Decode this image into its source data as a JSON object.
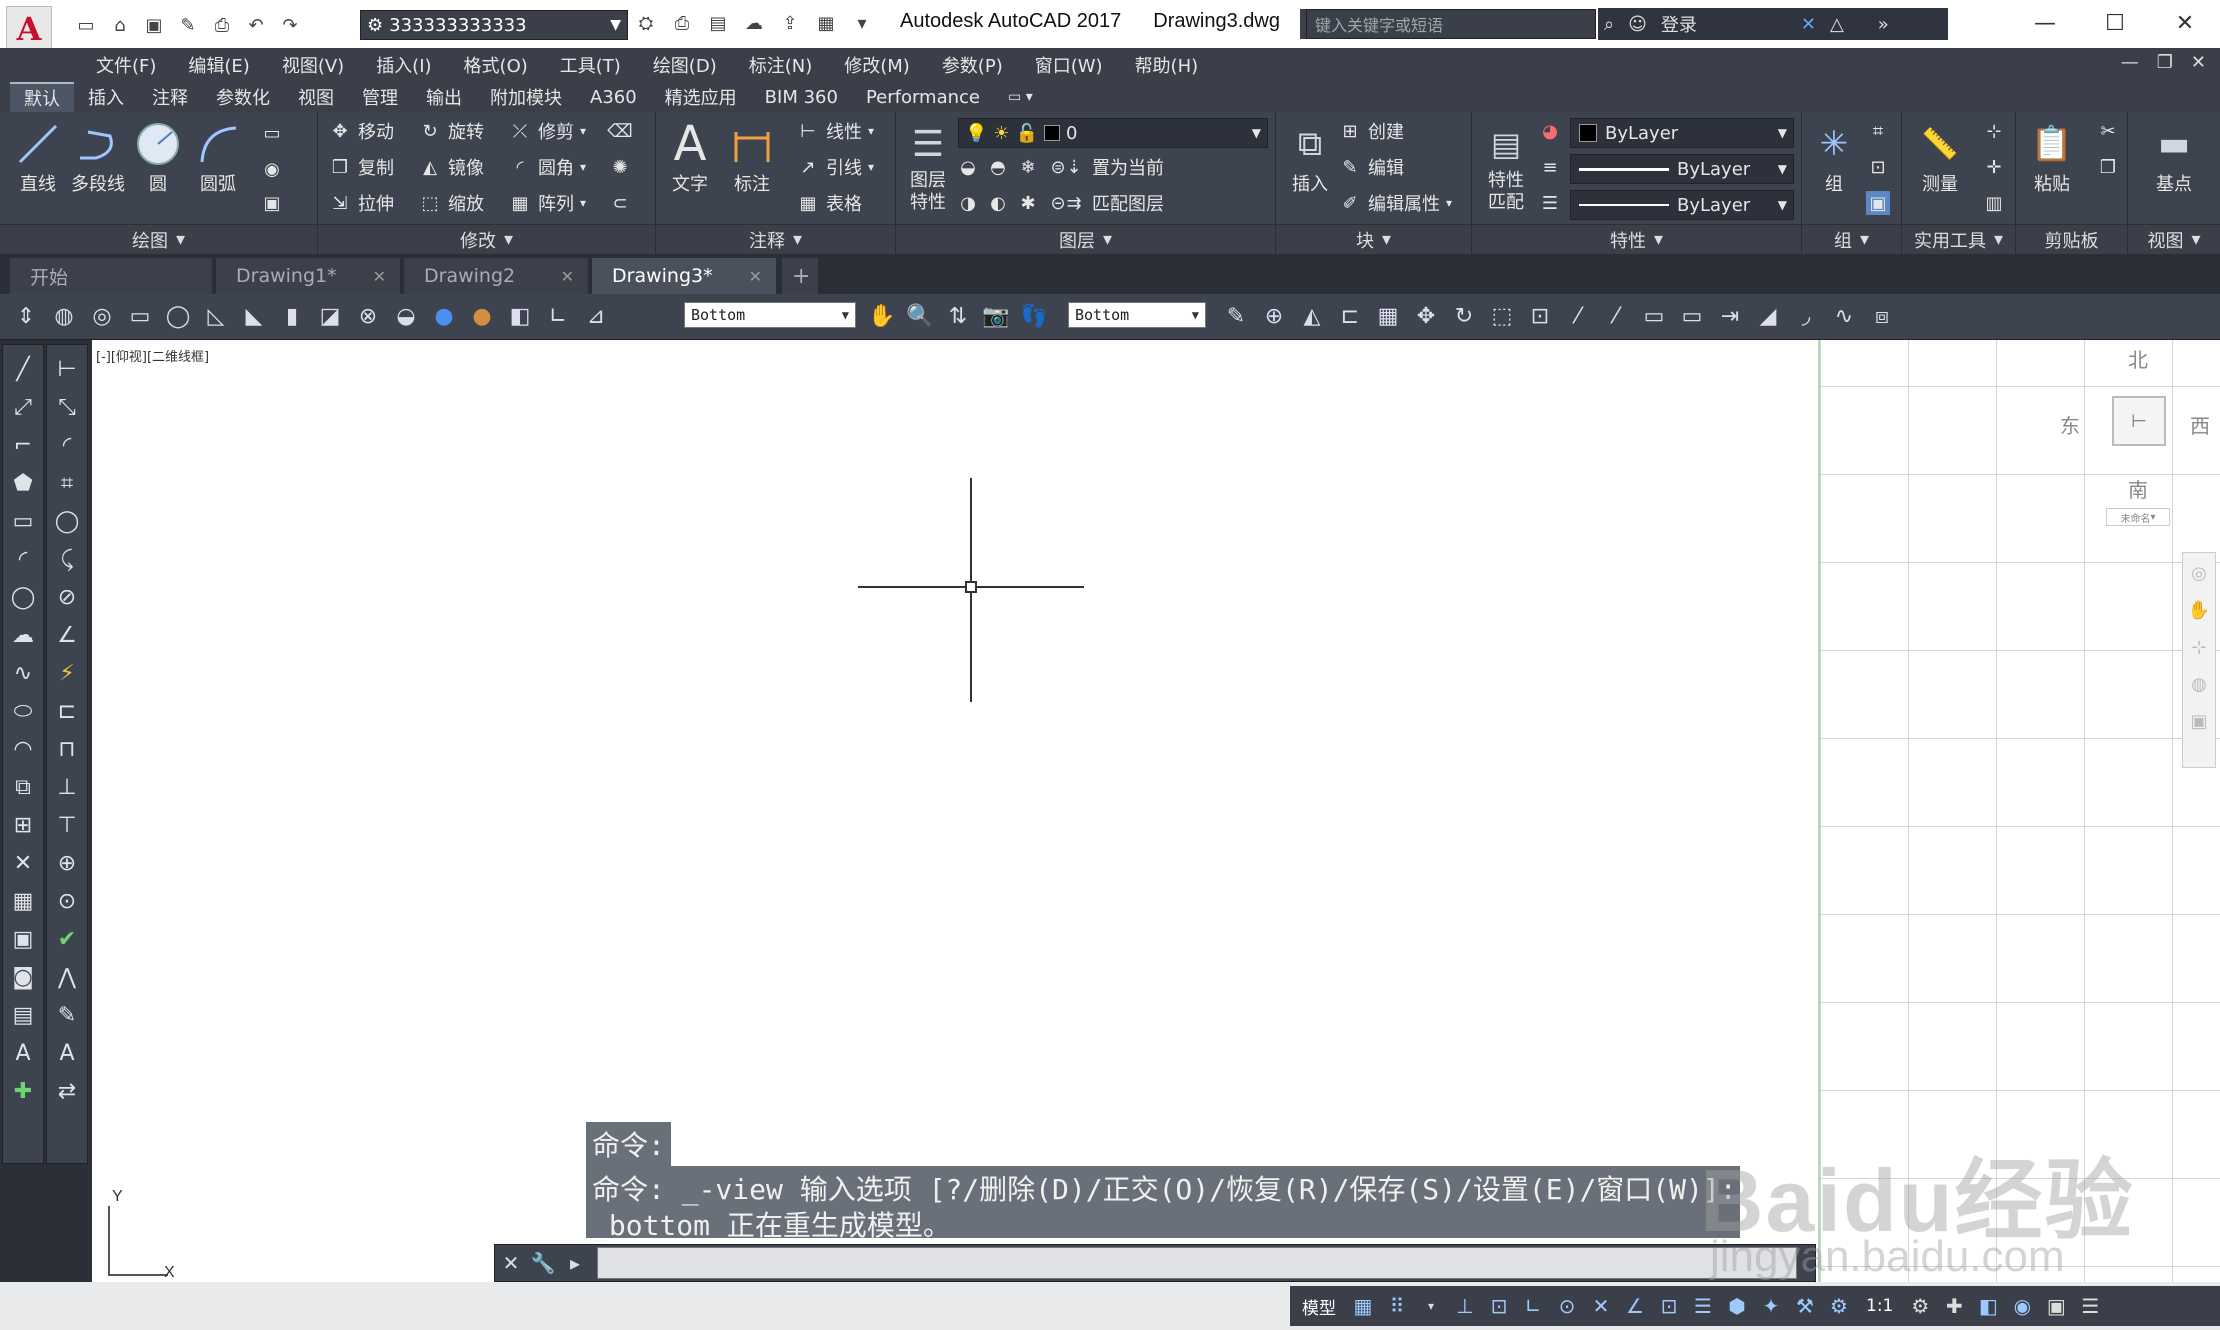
{
  "titlebar": {
    "workspace_name": "333333333333",
    "app_title": "Autodesk AutoCAD 2017",
    "doc_name": "Drawing3.dwg",
    "search_placeholder": "键入关键字或短语",
    "login_label": "登录"
  },
  "menu": [
    "文件(F)",
    "编辑(E)",
    "视图(V)",
    "插入(I)",
    "格式(O)",
    "工具(T)",
    "绘图(D)",
    "标注(N)",
    "修改(M)",
    "参数(P)",
    "窗口(W)",
    "帮助(H)"
  ],
  "ribbon_tabs": [
    "默认",
    "插入",
    "注释",
    "参数化",
    "视图",
    "管理",
    "输出",
    "附加模块",
    "A360",
    "精选应用",
    "BIM 360",
    "Performance"
  ],
  "ribbon": {
    "draw": {
      "title": "绘图",
      "line": "直线",
      "polyline": "多段线",
      "circle": "圆",
      "arc": "圆弧"
    },
    "modify": {
      "title": "修改",
      "move": "移动",
      "rotate": "旋转",
      "trim": "修剪",
      "copy": "复制",
      "mirror": "镜像",
      "fillet": "圆角",
      "stretch": "拉伸",
      "scale": "缩放",
      "array": "阵列"
    },
    "annotation": {
      "title": "注释",
      "text": "文字",
      "dimension": "标注",
      "linear": "线性",
      "leader": "引线",
      "table": "表格"
    },
    "layers": {
      "title": "图层",
      "layer_props": "图层\n特性",
      "current_layer": "0",
      "set_current": "置为当前",
      "match_layer": "匹配图层"
    },
    "block": {
      "title": "块",
      "insert": "插入",
      "create": "创建",
      "edit": "编辑",
      "edit_attr": "编辑属性"
    },
    "properties": {
      "title": "特性",
      "match": "特性\n匹配",
      "color": "ByLayer",
      "linetype": "ByLayer",
      "lineweight": "ByLayer"
    },
    "groups": {
      "title": "组",
      "group": "组"
    },
    "utilities": {
      "title": "实用工具",
      "measure": "测量"
    },
    "clipboard": {
      "title": "剪贴板",
      "paste": "粘贴"
    },
    "view": {
      "title": "视图",
      "base": "基点"
    }
  },
  "doc_tabs": [
    "开始",
    "Drawing1*",
    "Drawing2",
    "Drawing3*"
  ],
  "toolbar": {
    "view_combo_1": "Bottom",
    "view_combo_2": "Bottom"
  },
  "canvas": {
    "viewport_label": "[-][仰视][二维线框]",
    "ucs_x": "X",
    "ucs_y": "Y"
  },
  "viewcube": {
    "north": "北",
    "west": "东",
    "east": "西",
    "south": "南",
    "wcs": "未命名"
  },
  "command": {
    "hist1": "命令:",
    "hist2": "命令: _-view 输入选项 [?/删除(D)/正交(O)/恢复(R)/保存(S)/设置(E)/窗口(W)]:",
    "hist3": "_bottom 正在重生成模型。"
  },
  "status": {
    "model": "模型",
    "scale": "1:1"
  },
  "watermark": {
    "main": "Baidu经验",
    "sub": "jingyan.baidu.com"
  }
}
